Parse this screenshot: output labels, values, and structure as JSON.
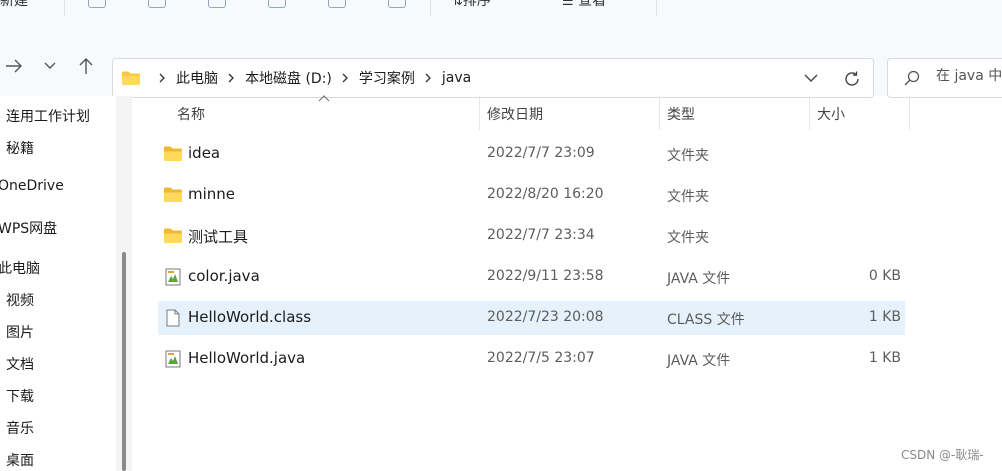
{
  "ribbon": {
    "new_label": "新建",
    "sort_label": "排序",
    "view_label": "查看"
  },
  "address": {
    "crumbs": [
      "此电脑",
      "本地磁盘 (D:)",
      "学习案例",
      "java"
    ]
  },
  "search": {
    "placeholder": "在 java 中搜索"
  },
  "sidebar": {
    "items": [
      {
        "label": "连用工作计划"
      },
      {
        "label": "秘籍"
      },
      {
        "label": "OneDrive"
      },
      {
        "label": "WPS网盘"
      },
      {
        "label": "此电脑"
      },
      {
        "label": "视频"
      },
      {
        "label": "图片"
      },
      {
        "label": "文档"
      },
      {
        "label": "下载"
      },
      {
        "label": "音乐"
      },
      {
        "label": "桌面"
      }
    ]
  },
  "columns": {
    "name": "名称",
    "date": "修改日期",
    "type": "类型",
    "size": "大小"
  },
  "files": [
    {
      "icon": "folder-icon",
      "name": "idea",
      "date": "2022/7/7 23:09",
      "type": "文件夹",
      "size": "",
      "selected": false
    },
    {
      "icon": "folder-icon",
      "name": "minne",
      "date": "2022/8/20 16:20",
      "type": "文件夹",
      "size": "",
      "selected": false
    },
    {
      "icon": "folder-icon",
      "name": "测试工具",
      "date": "2022/7/7 23:34",
      "type": "文件夹",
      "size": "",
      "selected": false
    },
    {
      "icon": "java-file-icon",
      "name": "color.java",
      "date": "2022/9/11 23:58",
      "type": "JAVA 文件",
      "size": "0 KB",
      "selected": false
    },
    {
      "icon": "blank-file-icon",
      "name": "HelloWorld.class",
      "date": "2022/7/23 20:08",
      "type": "CLASS 文件",
      "size": "1 KB",
      "selected": true
    },
    {
      "icon": "java-file-icon",
      "name": "HelloWorld.java",
      "date": "2022/7/5 23:07",
      "type": "JAVA 文件",
      "size": "1 KB",
      "selected": false
    }
  ],
  "watermark": "CSDN @-耿瑞-",
  "colors": {
    "selection": "#e5f1fb",
    "folder": "#f8c93f",
    "accent": "#0067c0"
  }
}
